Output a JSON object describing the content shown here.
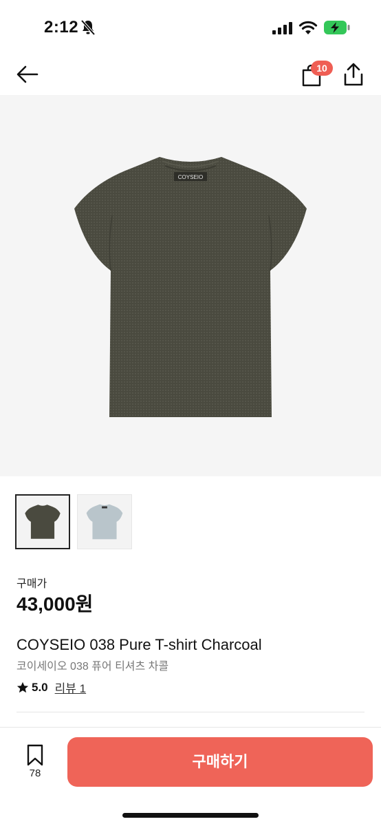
{
  "status_bar": {
    "time": "2:12",
    "icons": [
      "bell-slash-icon",
      "signal-icon",
      "wifi-icon",
      "battery-charging-icon"
    ]
  },
  "nav": {
    "cart_count": "10",
    "icons": [
      "back-arrow-icon",
      "shopping-bag-icon",
      "share-icon"
    ]
  },
  "product": {
    "brand_tag": "COYSEIO",
    "price_label": "구매가",
    "price": "43,000원",
    "title_en": "COYSEIO 038 Pure T-shirt Charcoal",
    "title_ko": "코이세이오 038 퓨어 티셔츠 차콜",
    "rating": "5.0",
    "review_label": "리뷰 1",
    "thumbnails": [
      {
        "color": "#4a4a3f"
      },
      {
        "color": "#b9c5cb"
      }
    ]
  },
  "bottom": {
    "bookmark_count": "78",
    "buy_label": "구매하기"
  },
  "colors": {
    "accent": "#ef6458",
    "badge": "#ef5e54",
    "shirt_main": "#4a4a3f",
    "battery": "#34c759"
  }
}
